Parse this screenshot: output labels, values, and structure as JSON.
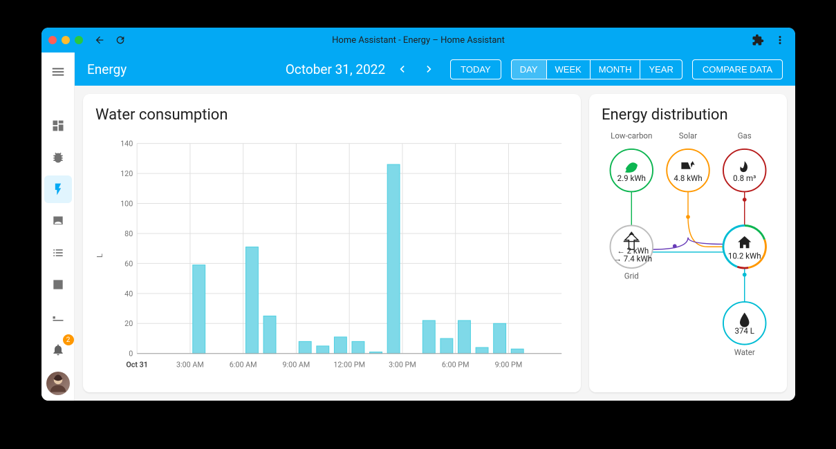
{
  "window": {
    "title": "Home Assistant - Energy – Home Assistant"
  },
  "sidebar": {
    "notification_count": "2"
  },
  "toolbar": {
    "page_title": "Energy",
    "date": "October 31, 2022",
    "today": "TODAY",
    "ranges": {
      "day": "DAY",
      "week": "WEEK",
      "month": "MONTH",
      "year": "YEAR"
    },
    "compare": "COMPARE DATA"
  },
  "water_card": {
    "title": "Water consumption"
  },
  "distribution": {
    "title": "Energy distribution",
    "low_carbon": {
      "label": "Low-carbon",
      "value": "2.9 kWh"
    },
    "solar": {
      "label": "Solar",
      "value": "4.8 kWh"
    },
    "gas": {
      "label": "Gas",
      "value": "0.8 m³"
    },
    "grid": {
      "label": "Grid",
      "out": "2 kWh",
      "in": "7.4 kWh"
    },
    "home": {
      "value": "10.2 kWh"
    },
    "water": {
      "label": "Water",
      "value": "374 L"
    }
  },
  "chart_data": {
    "type": "bar",
    "title": "Water consumption",
    "ylabel": "L",
    "ylim": [
      0,
      140
    ],
    "yticks": [
      0,
      20,
      40,
      60,
      80,
      100,
      120,
      140
    ],
    "x_labels": [
      "Oct 31",
      "3:00 AM",
      "6:00 AM",
      "9:00 AM",
      "12:00 PM",
      "3:00 PM",
      "6:00 PM",
      "9:00 PM"
    ],
    "x_tick_hours": [
      0,
      3,
      6,
      9,
      12,
      15,
      18,
      21
    ],
    "hours": [
      0,
      1,
      2,
      3,
      4,
      5,
      6,
      7,
      8,
      9,
      10,
      11,
      12,
      13,
      14,
      15,
      16,
      17,
      18,
      19,
      20,
      21,
      22,
      23
    ],
    "values": [
      0,
      0,
      0,
      59,
      0,
      0,
      71,
      25,
      0,
      8,
      5,
      11,
      8,
      1,
      126,
      0,
      22,
      10,
      22,
      4,
      20,
      3,
      0,
      0
    ]
  },
  "colors": {
    "primary": "#03a9f4",
    "bar": "#7fd9e8",
    "green": "#0db551",
    "orange": "#ff9800",
    "red": "#b71c1c",
    "purple": "#673ab7",
    "teal": "#00bcd4"
  }
}
